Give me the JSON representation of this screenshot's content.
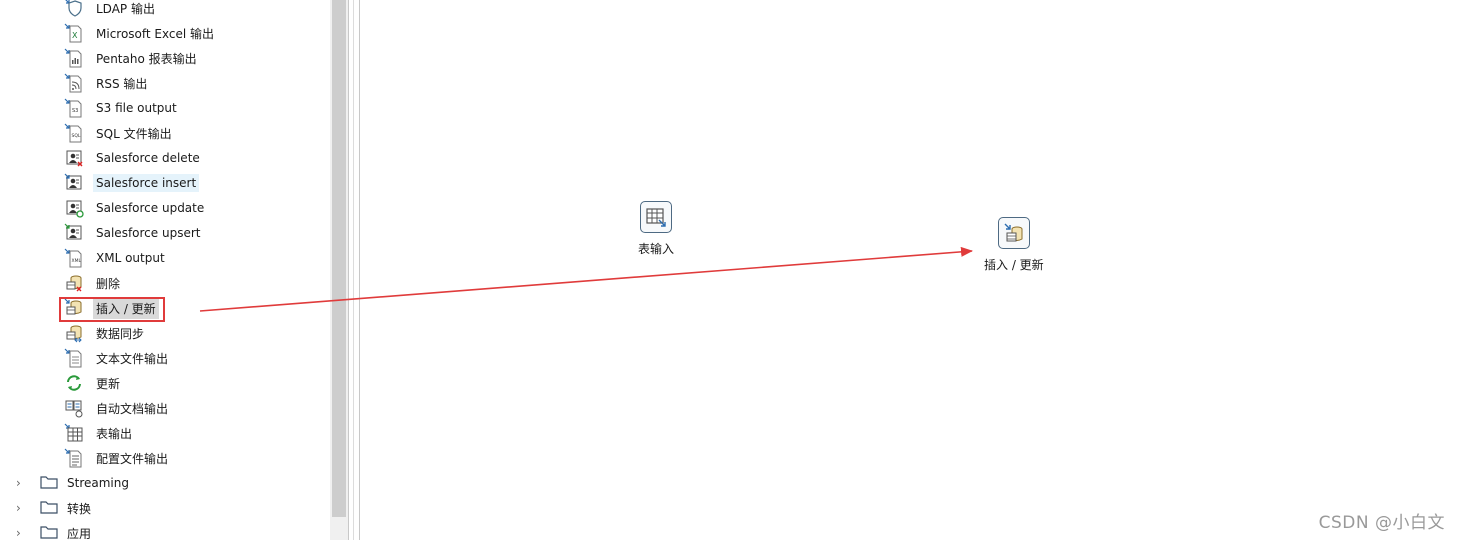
{
  "tree": {
    "output_items": [
      {
        "label": "LDAP 输出",
        "icon": "ldap-shield-icon"
      },
      {
        "label": "Microsoft Excel 输出",
        "icon": "excel-file-icon"
      },
      {
        "label": "Pentaho 报表输出",
        "icon": "report-file-icon"
      },
      {
        "label": "RSS 输出",
        "icon": "rss-file-icon"
      },
      {
        "label": "S3 file output",
        "icon": "s3-file-icon"
      },
      {
        "label": "SQL 文件输出",
        "icon": "sql-file-icon"
      },
      {
        "label": "Salesforce delete",
        "icon": "salesforce-delete-icon"
      },
      {
        "label": "Salesforce insert",
        "icon": "salesforce-insert-icon"
      },
      {
        "label": "Salesforce update",
        "icon": "salesforce-update-icon"
      },
      {
        "label": "Salesforce upsert",
        "icon": "salesforce-upsert-icon"
      },
      {
        "label": "XML output",
        "icon": "xml-file-icon"
      },
      {
        "label": "删除",
        "icon": "delete-db-icon"
      },
      {
        "label": "插入 / 更新",
        "icon": "insert-update-db-icon"
      },
      {
        "label": "数据同步",
        "icon": "sync-db-icon"
      },
      {
        "label": "文本文件输出",
        "icon": "text-file-icon"
      },
      {
        "label": "更新",
        "icon": "refresh-icon"
      },
      {
        "label": "自动文档输出",
        "icon": "auto-doc-icon"
      },
      {
        "label": "表输出",
        "icon": "table-output-icon"
      },
      {
        "label": "配置文件输出",
        "icon": "config-file-icon"
      }
    ],
    "folders": [
      {
        "label": "Streaming",
        "icon": "folder-icon"
      },
      {
        "label": "转换",
        "icon": "folder-icon"
      },
      {
        "label": "应用",
        "icon": "folder-icon"
      }
    ]
  },
  "canvas": {
    "step_table_input": {
      "label": "表输入",
      "icon": "table-input-icon"
    },
    "step_insert_update": {
      "label": "插入 / 更新",
      "icon": "insert-update-db-icon"
    }
  },
  "annotation": {
    "color": "#e03b3b"
  },
  "watermark": "CSDN @小白文"
}
